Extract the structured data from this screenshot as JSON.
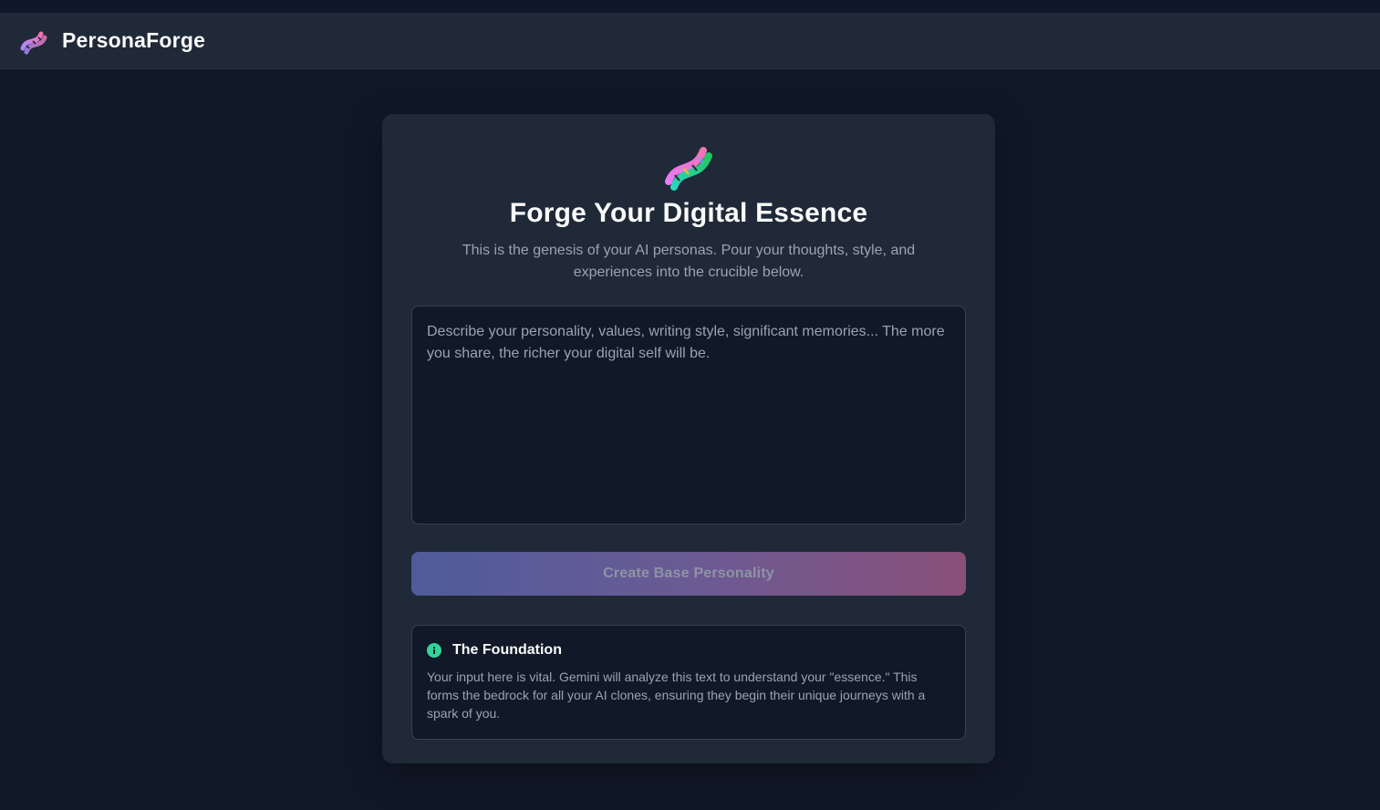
{
  "app": {
    "name": "PersonaForge",
    "logo_icon": "dna-icon"
  },
  "hero": {
    "icon": "dna-icon",
    "title": "Forge Your Digital Essence",
    "subtitle": "This is the genesis of your AI personas. Pour your thoughts, style, and experiences into the crucible below."
  },
  "essence_input": {
    "value": "",
    "placeholder": "Describe your personality, values, writing style, significant memories... The more you share, the richer your digital self will be."
  },
  "create_button": {
    "label": "Create Base Personality",
    "disabled": true
  },
  "info": {
    "icon": "info-circle-icon",
    "title": "The Foundation",
    "text": "Your input here is vital. Gemini will analyze this text to understand your \"essence.\" This forms the bedrock for all your AI clones, ensuring they begin their unique journeys with a spark of you."
  },
  "colors": {
    "background": "#111827",
    "surface": "#1f2937",
    "accent_start": "#4f5b9a",
    "accent_end": "#8a5079",
    "info_icon": "#34d399"
  }
}
